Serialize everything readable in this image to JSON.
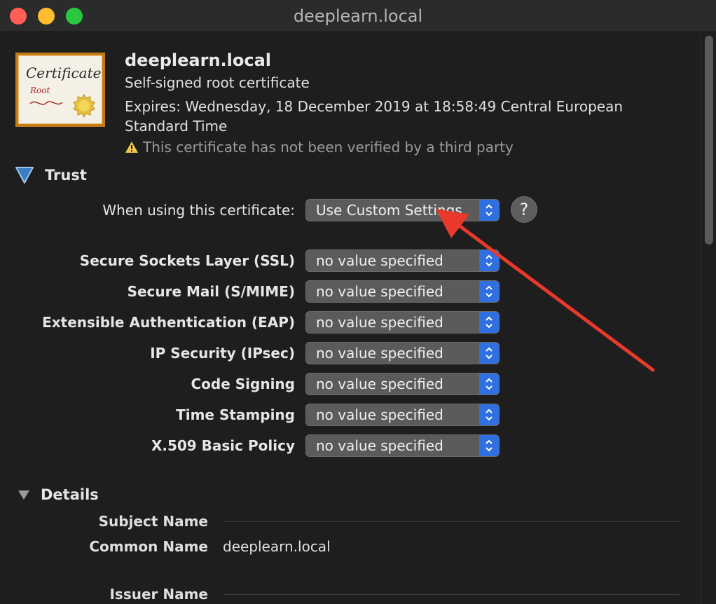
{
  "window": {
    "title": "deeplearn.local",
    "controls": [
      "close",
      "minimize",
      "zoom"
    ]
  },
  "certificate": {
    "icon": "certificate-icon",
    "icon_text": "Certificate",
    "icon_subtext": "Root",
    "name": "deeplearn.local",
    "type": "Self-signed root certificate",
    "expires": "Expires: Wednesday, 18 December 2019 at 18:58:49 Central European Standard Time",
    "warning": "This certificate has not been verified by a third party"
  },
  "trust": {
    "heading": "Trust",
    "when_using_label": "When using this certificate:",
    "when_using_value": "Use Custom Settings",
    "help_label": "?",
    "settings": [
      {
        "label": "Secure Sockets Layer (SSL)",
        "value": "no value specified"
      },
      {
        "label": "Secure Mail (S/MIME)",
        "value": "no value specified"
      },
      {
        "label": "Extensible Authentication (EAP)",
        "value": "no value specified"
      },
      {
        "label": "IP Security (IPsec)",
        "value": "no value specified"
      },
      {
        "label": "Code Signing",
        "value": "no value specified"
      },
      {
        "label": "Time Stamping",
        "value": "no value specified"
      },
      {
        "label": "X.509 Basic Policy",
        "value": "no value specified"
      }
    ]
  },
  "details": {
    "heading": "Details",
    "subject_name_label": "Subject Name",
    "common_name_label": "Common Name",
    "common_name_value": "deeplearn.local",
    "issuer_name_label": "Issuer Name"
  },
  "colors": {
    "accent": "#2f6fe0",
    "annotation_arrow": "#e8392b",
    "background": "#1e1e1e"
  }
}
